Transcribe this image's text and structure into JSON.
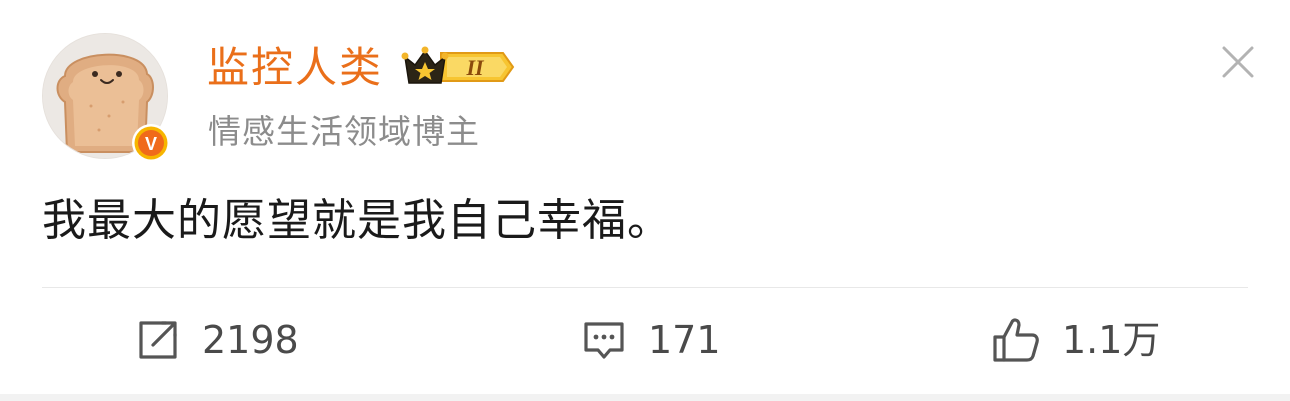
{
  "user": {
    "name": "监控人类",
    "description": "情感生活领域博主",
    "level_badge": "II",
    "verified_badge": "V"
  },
  "post": {
    "text": "我最大的愿望就是我自己幸福。"
  },
  "actions": {
    "repost": {
      "icon": "repost-icon",
      "count": "2198"
    },
    "comment": {
      "icon": "comment-icon",
      "count": "171"
    },
    "like": {
      "icon": "thumbs-up-icon",
      "count": "1.1万"
    }
  },
  "colors": {
    "name": "#ea6f1a",
    "verified": "#f08c1e",
    "secondary_text": "#8c8c8c",
    "body_text": "#1a1a1a"
  }
}
